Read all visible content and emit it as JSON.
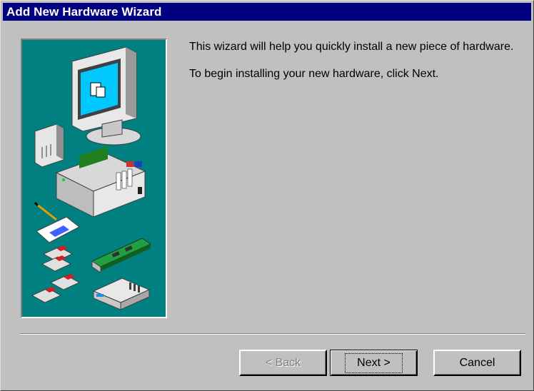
{
  "window": {
    "title": "Add New Hardware Wizard"
  },
  "illustration": {
    "icon": "hardware-collage",
    "background_color": "#008080"
  },
  "content": {
    "paragraph_1": "This wizard will help you quickly install a new piece of hardware.",
    "paragraph_2": "To begin installing your new hardware, click Next."
  },
  "buttons": {
    "back_label": "< Back",
    "next_label": "Next >",
    "cancel_label": "Cancel"
  },
  "colors": {
    "titlebar": "#000080",
    "dialog_face": "#c0c0c0"
  }
}
